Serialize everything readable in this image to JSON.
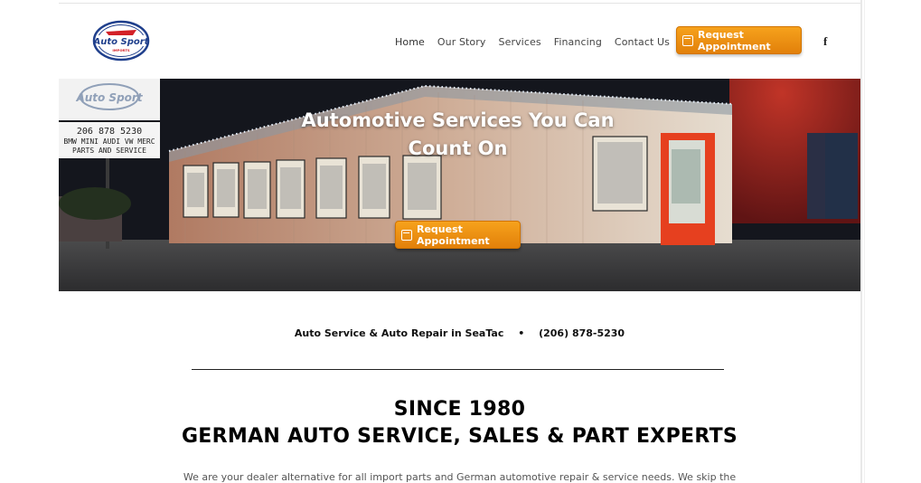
{
  "brand": {
    "logo_text": "Auto Sport",
    "logo_subtext": "IMPORTS"
  },
  "nav": {
    "items": [
      {
        "label": "Home"
      },
      {
        "label": "Our Story"
      },
      {
        "label": "Services"
      },
      {
        "label": "Financing"
      },
      {
        "label": "Contact Us"
      }
    ],
    "cta_label": "Request Appointment",
    "social_label": "f"
  },
  "hero": {
    "title_line1": "Automotive Services You Can",
    "title_line2": "Count On",
    "cta_label": "Request Appointment",
    "sign_phone": "206 878 5230",
    "sign_makes": "BMW MINI AUDI VW MERC",
    "sign_tagline": "PARTS AND SERVICE"
  },
  "info": {
    "service_text": "Auto Service & Auto Repair in SeaTac",
    "separator": "•",
    "phone": "(206) 878-5230"
  },
  "intro": {
    "since": "SINCE 1980",
    "experts": "GERMAN AUTO SERVICE, SALES & PART EXPERTS",
    "paragraph": "We are your dealer alternative for all import parts and German automotive repair & service needs. We skip the"
  },
  "colors": {
    "accent": "#f39a17",
    "door_red": "#e6401f",
    "logo_blue": "#1f3f8c",
    "logo_red": "#d32027"
  }
}
